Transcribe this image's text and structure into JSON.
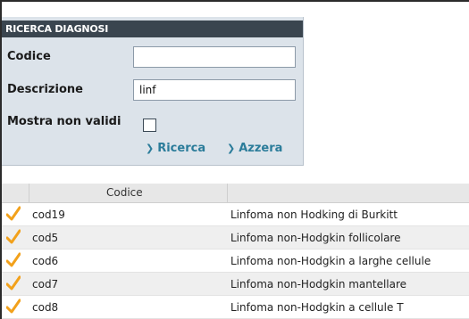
{
  "panel": {
    "title": "RICERCA DIAGNOSI",
    "codice_label": "Codice",
    "codice_value": "",
    "descrizione_label": "Descrizione",
    "descrizione_value": "linf",
    "non_validi_label": "Mostra non validi",
    "non_validi_checked": false,
    "search_label": "Ricerca",
    "reset_label": "Azzera"
  },
  "table": {
    "columns": [
      "",
      "Codice",
      ""
    ],
    "rows": [
      {
        "code": "cod19",
        "description": "Linfoma non Hodking di Burkitt"
      },
      {
        "code": "cod5",
        "description": "Linfoma non-Hodgkin follicolare"
      },
      {
        "code": "cod6",
        "description": "Linfoma non-Hodgkin a larghe cellule"
      },
      {
        "code": "cod7",
        "description": "Linfoma non-Hodgkin mantellare"
      },
      {
        "code": "cod8",
        "description": "Linfoma non-Hodgkin a cellule T"
      }
    ]
  },
  "colors": {
    "panel_bg": "#dce3ea",
    "header_bg": "#3a454f",
    "link": "#2b7c9a",
    "check": "#f2a11b"
  }
}
